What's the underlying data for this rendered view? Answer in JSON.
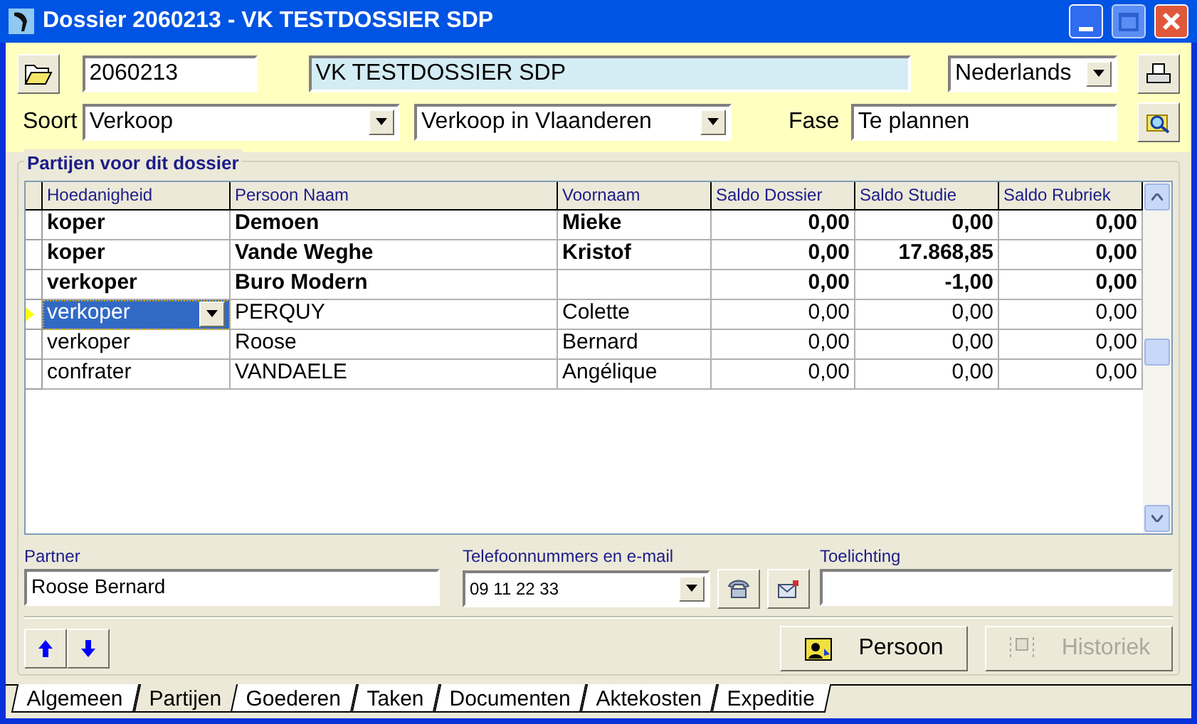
{
  "window": {
    "title": "Dossier 2060213 - VK TESTDOSSIER SDP"
  },
  "header": {
    "number": "2060213",
    "name": "VK TESTDOSSIER SDP",
    "language": "Nederlands",
    "soort_label": "Soort",
    "soort": "Verkoop",
    "subsoort": "Verkoop in Vlaanderen",
    "fase_label": "Fase",
    "fase": "Te plannen"
  },
  "group": {
    "title": "Partijen voor dit dossier"
  },
  "table": {
    "columns": [
      "Hoedanigheid",
      "Persoon Naam",
      "Voornaam",
      "Saldo Dossier",
      "Saldo Studie",
      "Saldo Rubriek"
    ],
    "rows": [
      {
        "cells": [
          "koper",
          "Demoen",
          "Mieke",
          "0,00",
          "0,00",
          "0,00"
        ],
        "bold": true,
        "selected": false
      },
      {
        "cells": [
          "koper",
          "Vande Weghe",
          "Kristof",
          "0,00",
          "17.868,85",
          "0,00"
        ],
        "bold": true,
        "selected": false
      },
      {
        "cells": [
          "verkoper",
          "Buro Modern",
          "",
          "0,00",
          "-1,00",
          "0,00"
        ],
        "bold": true,
        "selected": false
      },
      {
        "cells": [
          "verkoper",
          "PERQUY",
          "Colette",
          "0,00",
          "0,00",
          "0,00"
        ],
        "bold": false,
        "selected": true
      },
      {
        "cells": [
          "verkoper",
          "Roose",
          "Bernard",
          "0,00",
          "0,00",
          "0,00"
        ],
        "bold": false,
        "selected": false
      },
      {
        "cells": [
          "confrater",
          "VANDAELE",
          "Angélique",
          "0,00",
          "0,00",
          "0,00"
        ],
        "bold": false,
        "selected": false
      }
    ]
  },
  "details": {
    "partner_label": "Partner",
    "partner": "Roose Bernard",
    "phone_label": "Telefoonnummers en e-mail",
    "phone": "09 11 22 33",
    "note_label": "Toelichting"
  },
  "buttons": [
    {
      "label": "Persoon",
      "disabled": false
    },
    {
      "label": "Historiek",
      "disabled": true
    }
  ],
  "tabs": [
    {
      "label": "Algemeen",
      "selected": false
    },
    {
      "label": "Partijen",
      "selected": true
    },
    {
      "label": "Goederen",
      "selected": false
    },
    {
      "label": "Taken",
      "selected": false
    },
    {
      "label": "Documenten",
      "selected": false
    },
    {
      "label": "Aktekosten",
      "selected": false
    },
    {
      "label": "Expeditie",
      "selected": false
    }
  ]
}
